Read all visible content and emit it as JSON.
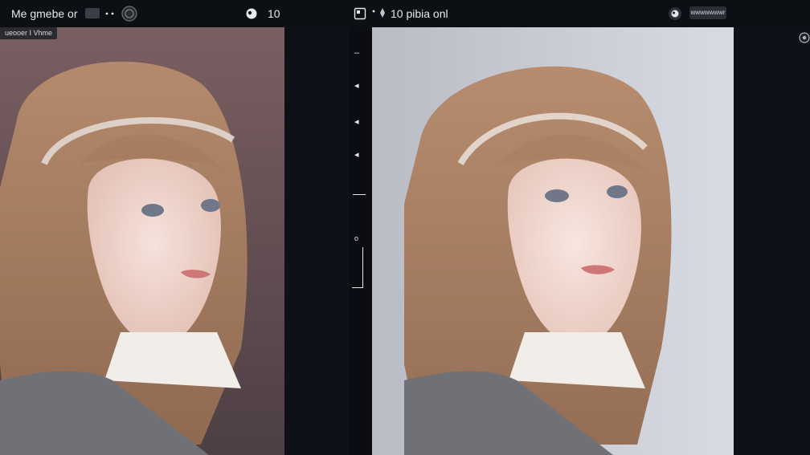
{
  "toolbar_left": {
    "title": "Me gmebe or",
    "counter": "10"
  },
  "toolbar_right": {
    "title": "10 pibia onl",
    "badge": "wwwwwwwr"
  },
  "left_panel": {
    "overlay_tag": "ueooer I Vhme"
  },
  "colors": {
    "app_bg": "#0e1117",
    "left_bg_top": "#7a5f62",
    "right_bg": "#c4c8d0"
  },
  "icons": [
    "image-icon",
    "dot-menu-icon",
    "globe-icon",
    "avatar-icon",
    "square-frame-icon",
    "brush-icon",
    "chevron-left-icon",
    "crop-icon",
    "gear-icon"
  ]
}
